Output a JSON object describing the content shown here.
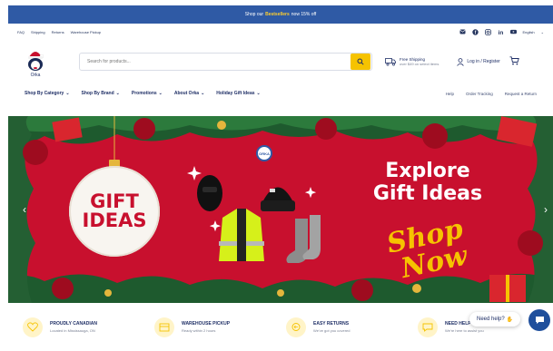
{
  "announcement": {
    "pre": "Shop our",
    "highlight": "Bestsellers",
    "post": "now 15% off"
  },
  "utility": {
    "links": [
      "FAQ",
      "Shipping",
      "Returns",
      "Warehouse Pickup"
    ],
    "language": "English"
  },
  "header": {
    "logo_name": "Orka",
    "search_placeholder": "Search for products...",
    "shipping_title": "Free Shipping",
    "shipping_sub": "over $49 on select items",
    "login": "Log in / Register"
  },
  "nav": {
    "items": [
      "Shop By Category",
      "Shop By Brand",
      "Promotions",
      "About Orka",
      "Holiday Gift Ideas"
    ],
    "right": [
      "Help",
      "Order Tracking",
      "Request a Return"
    ]
  },
  "hero": {
    "ornament_line1": "GIFT",
    "ornament_line2": "IDEAS",
    "headline_line1": "Explore",
    "headline_line2": "Gift Ideas",
    "script_line1": "Shop",
    "script_line2": "Now",
    "badge": "ORKA"
  },
  "features": [
    {
      "title": "PROUDLY CANADIAN",
      "sub": "Located in Mississauga, ON",
      "icon": "heart-icon"
    },
    {
      "title": "WAREHOUSE PICKUP",
      "sub": "Ready within 2 hours",
      "icon": "box-icon"
    },
    {
      "title": "EASY RETURNS",
      "sub": "We've got you covered",
      "icon": "return-icon"
    },
    {
      "title": "NEED HELP?",
      "sub": "We're here to assist you",
      "icon": "chat-icon"
    }
  ],
  "chat": {
    "label": "Need help?"
  },
  "colors": {
    "announce": "#2f5aa5",
    "accent": "#f6c300",
    "hero": "#c8102e",
    "navy": "#1f2f66"
  }
}
